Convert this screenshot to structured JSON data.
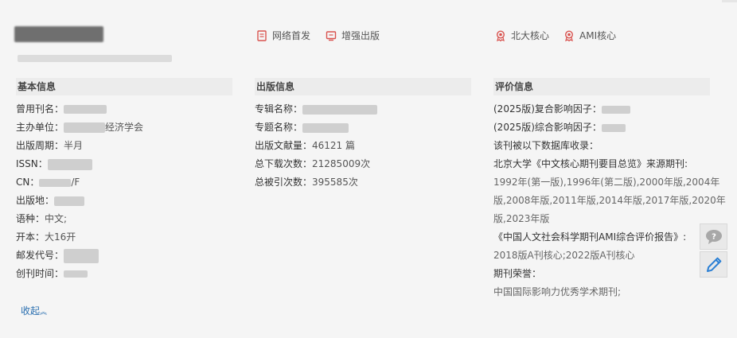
{
  "header": {
    "tags": [
      {
        "label": "网络首发",
        "icon": "document-icon"
      },
      {
        "label": "增强出版",
        "icon": "enhanced-publish-icon"
      },
      {
        "label": "北大核心",
        "icon": "award-badge-icon"
      },
      {
        "label": "AMI核心",
        "icon": "award-badge-icon"
      }
    ]
  },
  "basic": {
    "title": "基本信息",
    "rows": [
      {
        "label": "曾用刊名：",
        "value": ""
      },
      {
        "label": "主办单位：",
        "value": "经济学会"
      },
      {
        "label": "出版周期：",
        "value": "半月"
      },
      {
        "label": "ISSN：",
        "value": ""
      },
      {
        "label": "CN：",
        "value": "/F"
      },
      {
        "label": "出版地：",
        "value": ""
      },
      {
        "label": "语种：",
        "value": "中文;"
      },
      {
        "label": "开本：",
        "value": "大16开"
      },
      {
        "label": "邮发代号：",
        "value": ""
      },
      {
        "label": "创刊时间：",
        "value": ""
      }
    ],
    "collapse_label": "收起"
  },
  "publish": {
    "title": "出版信息",
    "rows": [
      {
        "label": "专辑名称：",
        "value": ""
      },
      {
        "label": "专题名称：",
        "value": ""
      },
      {
        "label": "出版文献量：",
        "value": "46121 篇"
      },
      {
        "label": "总下载次数：",
        "value": "21285009次"
      },
      {
        "label": "总被引次数：",
        "value": "395585次"
      }
    ]
  },
  "evaluation": {
    "title": "评价信息",
    "lines": [
      "(2025版)复合影响因子：",
      "(2025版)综合影响因子：",
      "该刊被以下数据库收录：",
      "北京大学《中文核心期刊要目总览》来源期刊:",
      "1992年(第一版),1996年(第二版),2000年版,2004年",
      "版,2008年版,2011年版,2014年版,2017年版,2020年",
      "版,2023年版",
      "《中国人文社会科学期刊AMI综合评价报告》:",
      "2018版A刊核心;2022版A刊核心",
      "期刊荣誉：",
      "中国国际影响力优秀学术期刊;"
    ]
  },
  "side_buttons": [
    {
      "icon": "help-chat-icon"
    },
    {
      "icon": "edit-pencil-icon"
    }
  ],
  "colors": {
    "accent_red": "#d9534f",
    "link_blue": "#2a6fb0"
  }
}
